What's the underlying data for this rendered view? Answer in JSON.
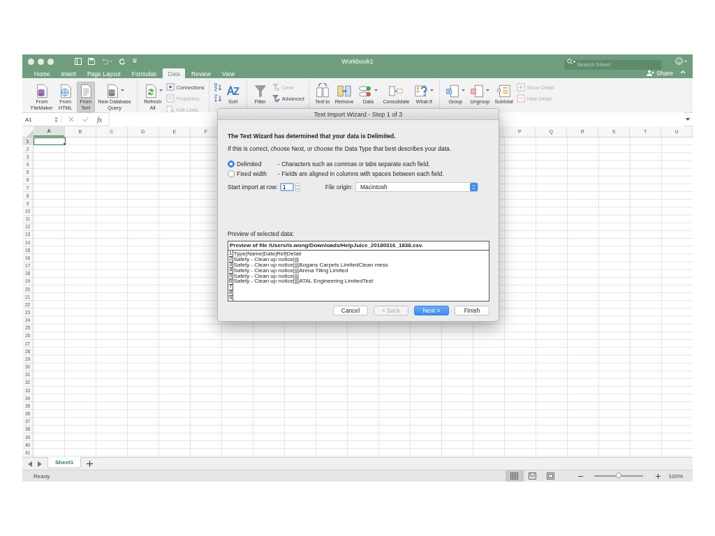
{
  "window": {
    "title": "Workbook1",
    "search": {
      "placeholder": "Search Sheet"
    },
    "share": "Share"
  },
  "tabs": [
    {
      "label": "Home",
      "selected": false
    },
    {
      "label": "Insert",
      "selected": false
    },
    {
      "label": "Page Layout",
      "selected": false
    },
    {
      "label": "Formulas",
      "selected": false
    },
    {
      "label": "Data",
      "selected": true
    },
    {
      "label": "Review",
      "selected": false
    },
    {
      "label": "View",
      "selected": false
    }
  ],
  "ribbon": {
    "groups": [
      {
        "items": [
          {
            "kind": "large",
            "label": "From\nFileMaker",
            "disabled": false,
            "selected": false,
            "caret": false
          },
          {
            "kind": "large",
            "label": "From\nHTML",
            "disabled": false,
            "selected": false,
            "caret": false
          },
          {
            "kind": "large",
            "label": "From\nText",
            "disabled": false,
            "selected": true,
            "caret": false
          },
          {
            "kind": "large",
            "label": "New Database\nQuery",
            "disabled": false,
            "selected": false,
            "caret": true
          }
        ]
      },
      {
        "items": [
          {
            "kind": "large",
            "label": "Refresh\nAll",
            "disabled": false,
            "selected": false,
            "caret": true
          },
          {
            "kind": "stack",
            "children": [
              {
                "label": "Connections",
                "disabled": false
              },
              {
                "label": "Properties",
                "disabled": true
              },
              {
                "label": "Edit Links",
                "disabled": true
              }
            ]
          }
        ]
      },
      {
        "items": [
          {
            "kind": "sort_icons"
          },
          {
            "kind": "large",
            "label": "Sort",
            "disabled": false,
            "selected": false,
            "caret": false
          }
        ]
      },
      {
        "items": [
          {
            "kind": "large",
            "label": "Filter",
            "disabled": false,
            "selected": false,
            "caret": false
          },
          {
            "kind": "stack",
            "children": [
              {
                "label": "Clear",
                "disabled": true
              },
              {
                "label": "Advanced",
                "disabled": false
              }
            ]
          }
        ]
      },
      {
        "items": [
          {
            "kind": "large",
            "label": "Text to",
            "disabled": false,
            "selected": false,
            "caret": false
          },
          {
            "kind": "large",
            "label": "Remove",
            "disabled": false,
            "selected": false,
            "caret": false
          },
          {
            "kind": "large",
            "label": "Data",
            "disabled": false,
            "selected": false,
            "caret": true
          },
          {
            "kind": "large",
            "label": "Consolidate",
            "disabled": false,
            "selected": false,
            "caret": false
          },
          {
            "kind": "large",
            "label": "What-If",
            "disabled": false,
            "selected": false,
            "caret": true
          }
        ]
      },
      {
        "items": [
          {
            "kind": "large",
            "label": "Group",
            "disabled": false,
            "selected": false,
            "caret": true
          },
          {
            "kind": "large",
            "label": "Ungroup",
            "disabled": false,
            "selected": false,
            "caret": true
          },
          {
            "kind": "large",
            "label": "Subtotal",
            "disabled": false,
            "selected": false,
            "caret": false
          },
          {
            "kind": "stack",
            "children": [
              {
                "label": "Show Detail",
                "disabled": true
              },
              {
                "label": "Hide Detail",
                "disabled": true
              }
            ]
          }
        ]
      }
    ]
  },
  "formula_bar": {
    "name_box": "A1",
    "fx": "fx"
  },
  "sheet": {
    "columns_left": [
      {
        "label": "A",
        "selected": true
      },
      {
        "label": "B",
        "selected": false
      },
      {
        "label": "C",
        "selected": false
      },
      {
        "label": "D",
        "selected": false
      },
      {
        "label": "E",
        "selected": false
      },
      {
        "label": "F",
        "selected": false
      }
    ],
    "columns_right": [
      {
        "label": "P",
        "selected": false
      },
      {
        "label": "Q",
        "selected": false
      },
      {
        "label": "R",
        "selected": false
      },
      {
        "label": "S",
        "selected": false
      },
      {
        "label": "T",
        "selected": false
      },
      {
        "label": "U",
        "selected": false
      }
    ],
    "rows": [
      {
        "label": "1",
        "selected": true
      },
      {
        "label": "2",
        "selected": false
      },
      {
        "label": "3",
        "selected": false
      },
      {
        "label": "4",
        "selected": false
      },
      {
        "label": "5",
        "selected": false
      },
      {
        "label": "6",
        "selected": false
      },
      {
        "label": "7",
        "selected": false
      },
      {
        "label": "8",
        "selected": false
      },
      {
        "label": "9",
        "selected": false
      },
      {
        "label": "10",
        "selected": false
      },
      {
        "label": "11",
        "selected": false
      },
      {
        "label": "12",
        "selected": false
      },
      {
        "label": "13",
        "selected": false
      },
      {
        "label": "14",
        "selected": false
      },
      {
        "label": "15",
        "selected": false
      },
      {
        "label": "16",
        "selected": false
      },
      {
        "label": "17",
        "selected": false
      },
      {
        "label": "18",
        "selected": false
      },
      {
        "label": "19",
        "selected": false
      },
      {
        "label": "20",
        "selected": false
      },
      {
        "label": "21",
        "selected": false
      },
      {
        "label": "22",
        "selected": false
      },
      {
        "label": "23",
        "selected": false
      },
      {
        "label": "24",
        "selected": false
      },
      {
        "label": "25",
        "selected": false
      },
      {
        "label": "26",
        "selected": false
      },
      {
        "label": "27",
        "selected": false
      },
      {
        "label": "28",
        "selected": false
      },
      {
        "label": "29",
        "selected": false
      },
      {
        "label": "30",
        "selected": false
      },
      {
        "label": "31",
        "selected": false
      },
      {
        "label": "32",
        "selected": false
      },
      {
        "label": "33",
        "selected": false
      },
      {
        "label": "34",
        "selected": false
      },
      {
        "label": "35",
        "selected": false
      },
      {
        "label": "36",
        "selected": false
      },
      {
        "label": "37",
        "selected": false
      },
      {
        "label": "38",
        "selected": false
      },
      {
        "label": "39",
        "selected": false
      },
      {
        "label": "40",
        "selected": false
      },
      {
        "label": "41",
        "selected": false
      }
    ]
  },
  "sheet_tabs": [
    {
      "label": "Sheet1",
      "selected": true
    }
  ],
  "status_bar": {
    "status": "Ready",
    "views": [
      {
        "selected": true
      },
      {
        "selected": false
      },
      {
        "selected": false
      }
    ],
    "zoom": {
      "level": 0.5,
      "reading": "100%"
    }
  },
  "dialog": {
    "title": "Text Import Wizard - Step 1 of 3",
    "heading": "The Text Wizard has determined that your data is Delimited.",
    "instruction": "If this is correct, choose Next, or choose the Data Type that best describes your data.",
    "data_types": [
      {
        "label": "Delimited",
        "description": "- Characters such as commas or tabs separate each field.",
        "selected": true
      },
      {
        "label": "Fixed width",
        "description": "- Fields are aligned in columns with spaces between each field.",
        "selected": false
      }
    ],
    "start_row": {
      "label": "Start import at row:",
      "value": "1"
    },
    "file_origin": {
      "label": "File origin:",
      "value": "Macintosh"
    },
    "preview": {
      "label": "Preview of selected data:",
      "title": "Preview of file /Users/ls.wong/Downloads/HelpJuice_20180316_1838.csv.",
      "rows": [
        {
          "number": "1",
          "text": "Type|Name|Date|Ref|Detail"
        },
        {
          "number": "2",
          "text": "Safety - Clean up notice||||"
        },
        {
          "number": "3",
          "text": "Safety - Clean up notice||||Bogans Carpets LimitedClean mess"
        },
        {
          "number": "4",
          "text": "Safety - Clean up notice||||Arena Tiling Limited"
        },
        {
          "number": "5",
          "text": "Safety - Clean up notice||||"
        },
        {
          "number": "6",
          "text": "Safety - Clean up notice||||ATAL Engineering LimitedTest"
        },
        {
          "number": "7"
        },
        {
          "number": "8"
        },
        {
          "number": "9"
        }
      ]
    },
    "buttons": [
      {
        "label": "Cancel",
        "disabled": false,
        "default": false
      },
      {
        "label": "< Back",
        "disabled": true,
        "default": false
      },
      {
        "label": "Next >",
        "disabled": false,
        "default": true
      },
      {
        "label": "Finish",
        "disabled": false,
        "default": false
      }
    ]
  }
}
